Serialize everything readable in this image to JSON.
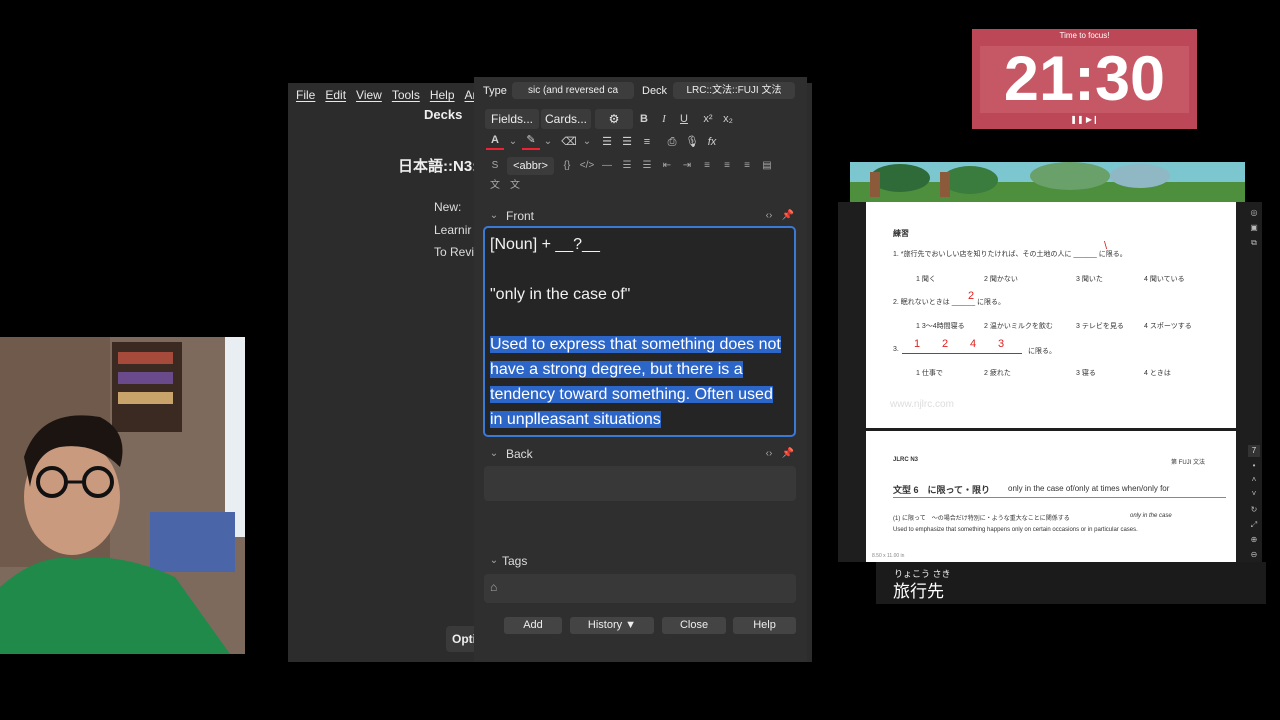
{
  "anki_main": {
    "menu": [
      "File",
      "Edit",
      "View",
      "Tools",
      "Help",
      "Anki"
    ],
    "decks_label": "Decks",
    "deck_title": "日本語::N3:",
    "stats": [
      "New:",
      "Learnir",
      "To Revi"
    ],
    "options_label": "Opti"
  },
  "add_dialog": {
    "type_label": "Type",
    "type_value": "sic (and reversed ca",
    "deck_label": "Deck",
    "deck_value": "LRC::文法::FUJI 文法",
    "fields_btn": "Fields...",
    "cards_btn": "Cards...",
    "abbr_btn": "<abbr>",
    "front_label": "Front",
    "front_lines": [
      "[Noun] + __?__",
      "\"only in the case of\""
    ],
    "front_selected": "Used to express that something does not have a strong degree, but there is a tendency toward something. Often used in unplleasant situations",
    "back_label": "Back",
    "tags_label": "Tags",
    "buttons": {
      "add": "Add",
      "history": "History ▼",
      "close": "Close",
      "help": "Help"
    }
  },
  "timer": {
    "caption": "Time to focus!",
    "time": "21:30",
    "controls": "❚❚ ▶❙",
    "bg_color": "#bc4756"
  },
  "pdf": {
    "page1": {
      "heading": "練習",
      "q1": "1. *旅行先でおいしい店を知りたければ、その土地の人に ______ に限る。",
      "q1_answer": "\\",
      "q1_opts": [
        "1 聞く",
        "2 聞かない",
        "3 聞いた",
        "4 聞いている"
      ],
      "q2": "2. 眠れないときは ______ に限る。",
      "q2_answer": "2",
      "q2_opts": [
        "1 3〜4時間寝る",
        "2 温かいミルクを飲む",
        "3 テレビを見る",
        "4 スポーツする"
      ],
      "q3_prefix": "3.",
      "q3_answers": [
        "1",
        "2",
        "4",
        "3"
      ],
      "q3_suffix": "に限る。",
      "q3_opts": [
        "1 仕事で",
        "2 疲れた",
        "3 寝る",
        "4 ときは"
      ],
      "watermark": "www.njlrc.com"
    },
    "page2": {
      "header_left": "JLRC N3",
      "header_right": "第 FUJI 文法",
      "title_jp": "文型 6　に限って・限り",
      "title_en": "only in the case of/only at times when/only for",
      "line1_jp": "(1) に限って　〜の場合だけ特別に・ような重大なことに関係する",
      "line1_en": "only in the case",
      "line2": "Used to emphasize that something happens only on certain occasions or in particular cases.",
      "footer": "8.50 x 11.00 in"
    },
    "page_num": "7",
    "subtitle_furigana": "りょこう さき",
    "subtitle": "旅行先"
  }
}
